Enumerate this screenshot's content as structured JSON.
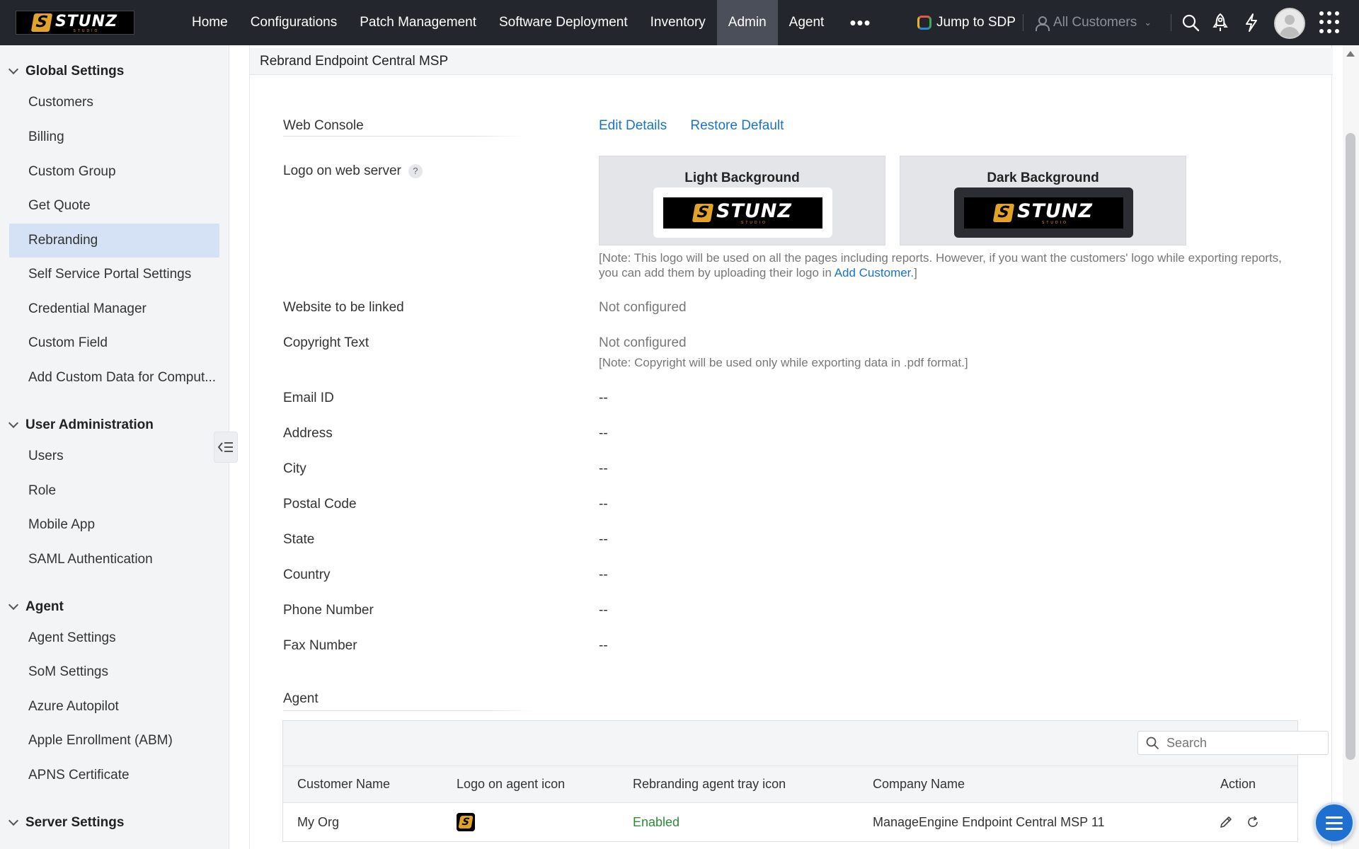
{
  "brand": {
    "logo_text": "STUNZ",
    "logo_sub": "STUDIO",
    "logo_mark": "S",
    "accent": "#e2a22a"
  },
  "topnav": {
    "items": [
      {
        "label": "Home"
      },
      {
        "label": "Configurations"
      },
      {
        "label": "Patch Management"
      },
      {
        "label": "Software Deployment"
      },
      {
        "label": "Inventory"
      },
      {
        "label": "Admin"
      },
      {
        "label": "Agent"
      }
    ],
    "active": "Admin",
    "more_label": "•••",
    "jump_label": "Jump to SDP",
    "customer_selector": "All Customers",
    "icons": [
      "search-icon",
      "rocket-icon",
      "lightning-icon",
      "avatar",
      "apps-grid-icon"
    ]
  },
  "sidebar": {
    "sections": [
      {
        "title": "Global Settings",
        "items": [
          {
            "label": "Customers"
          },
          {
            "label": "Billing"
          },
          {
            "label": "Custom Group"
          },
          {
            "label": "Get Quote"
          },
          {
            "label": "Rebranding",
            "active": true
          },
          {
            "label": "Self Service Portal Settings"
          },
          {
            "label": "Credential Manager"
          },
          {
            "label": "Custom Field"
          },
          {
            "label": "Add Custom Data for Comput..."
          }
        ]
      },
      {
        "title": "User Administration",
        "items": [
          {
            "label": "Users"
          },
          {
            "label": "Role"
          },
          {
            "label": "Mobile App"
          },
          {
            "label": "SAML Authentication"
          }
        ]
      },
      {
        "title": "Agent",
        "items": [
          {
            "label": "Agent Settings"
          },
          {
            "label": "SoM Settings"
          },
          {
            "label": "Azure Autopilot"
          },
          {
            "label": "Apple Enrollment (ABM)"
          },
          {
            "label": "APNS Certificate"
          }
        ]
      },
      {
        "title": "Server Settings",
        "items": []
      }
    ]
  },
  "main": {
    "page_title": "Rebrand Endpoint Central MSP",
    "web_console": {
      "heading": "Web Console",
      "edit_label": "Edit Details",
      "restore_label": "Restore Default"
    },
    "logo_row": {
      "label": "Logo on web server",
      "help": "?",
      "light_title": "Light Background",
      "dark_title": "Dark Background",
      "note_prefix": "[Note: This logo will be used on all the pages including reports. However, if you want the customers' logo while exporting reports,",
      "note_line2": "you can add them by uploading their logo in ",
      "note_link": "Add Customer.",
      "note_suffix": "]"
    },
    "fields": [
      {
        "label": "Website to be linked",
        "value": "Not configured"
      },
      {
        "label": "Copyright Text",
        "value": "Not configured"
      },
      {
        "label": "Email ID",
        "value": "--"
      },
      {
        "label": "Address",
        "value": "--"
      },
      {
        "label": "City",
        "value": "--"
      },
      {
        "label": "Postal Code",
        "value": "--"
      },
      {
        "label": "State",
        "value": "--"
      },
      {
        "label": "Country",
        "value": "--"
      },
      {
        "label": "Phone Number",
        "value": "--"
      },
      {
        "label": "Fax Number",
        "value": "--"
      }
    ],
    "copyright_note": "[Note: Copyright will be used only while exporting data in .pdf format.]",
    "agent": {
      "heading": "Agent",
      "search_placeholder": "Search",
      "columns": [
        "Customer Name",
        "Logo on agent icon",
        "Rebranding agent tray icon",
        "Company Name",
        "Action"
      ],
      "rows": [
        {
          "customer": "My Org",
          "tray_status": "Enabled",
          "company": "ManageEngine Endpoint Central MSP 11"
        }
      ]
    }
  }
}
